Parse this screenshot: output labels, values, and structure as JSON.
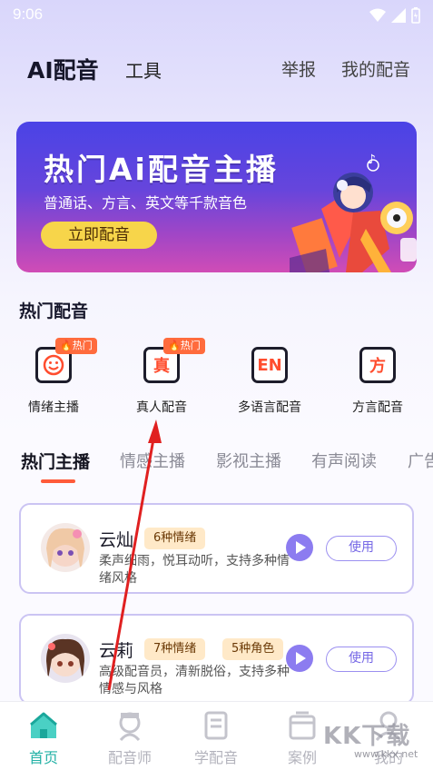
{
  "status": {
    "time": "9:06"
  },
  "header": {
    "app_title": "AI配音",
    "tools": "工具",
    "report": "举报",
    "my_dubbing": "我的配音"
  },
  "banner": {
    "title": "热门Ai配音主播",
    "subtitle": "普通话、方言、英文等千款音色",
    "button": "立即配音"
  },
  "hot_section": {
    "title": "热门配音",
    "categories": [
      {
        "label": "情绪主播",
        "glyph": "☺",
        "badge": "热门"
      },
      {
        "label": "真人配音",
        "glyph": "真",
        "badge": "热门"
      },
      {
        "label": "多语言配音",
        "glyph": "EN",
        "badge": ""
      },
      {
        "label": "方言配音",
        "glyph": "方",
        "badge": ""
      }
    ]
  },
  "tabs": [
    "热门主播",
    "情感主播",
    "影视主播",
    "有声阅读",
    "广告"
  ],
  "cards": [
    {
      "name": "云灿",
      "tags": [
        "6种情绪"
      ],
      "desc": "柔声细雨，悦耳动听，支持多种情绪风格",
      "use": "使用"
    },
    {
      "name": "云莉",
      "tags": [
        "7种情绪",
        "5种角色"
      ],
      "desc": "高级配音员，清新脱俗，支持多种情感与风格",
      "use": "使用"
    }
  ],
  "bottom_nav": [
    {
      "label": "首页",
      "active": true
    },
    {
      "label": "配音师"
    },
    {
      "label": "学配音"
    },
    {
      "label": "案例"
    },
    {
      "label": "我的"
    }
  ],
  "watermark": {
    "text": "KK下载",
    "url": "www.kkx.net"
  },
  "colors": {
    "accent": "#ff5b3a",
    "primary": "#7668e6",
    "nav_active": "#23b1a6"
  }
}
